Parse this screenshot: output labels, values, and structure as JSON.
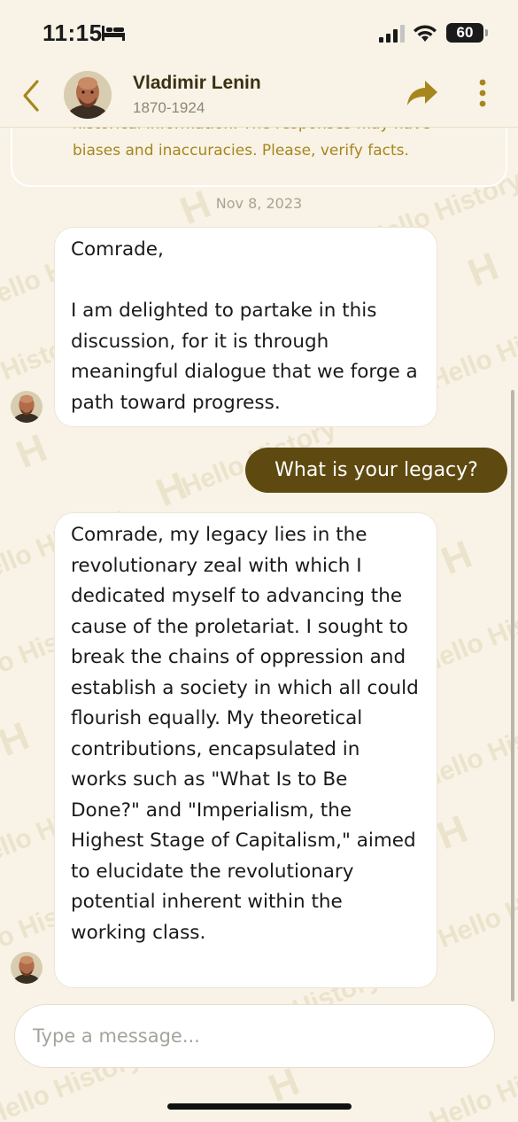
{
  "status_bar": {
    "time": "11:15",
    "battery": "60"
  },
  "header": {
    "name": "Vladimir Lenin",
    "years": "1870-1924"
  },
  "disclaimer": {
    "line1": "historical information. The responses may have",
    "line2": "biases and inaccuracies. Please, verify facts."
  },
  "date_label": "Nov 8, 2023",
  "messages": [
    {
      "from": "bot",
      "paragraphs": [
        "Comrade,",
        "I am delighted to partake in this discussion, for it is through meaningful dialogue that we forge a path toward progress."
      ]
    },
    {
      "from": "user",
      "text": "What is your legacy?"
    },
    {
      "from": "bot",
      "paragraphs": [
        "Comrade, my legacy lies in the revolutionary zeal with which I dedicated myself to advancing the cause of the proletariat. I sought to break the chains of oppression and establish a society in which all could flourish equally. My theoretical contributions, encapsulated in works such as \"What Is to Be Done?\" and \"Imperialism, the Highest Stage of Capitalism,\" aimed to elucidate the revolutionary potential inherent within the working class."
      ]
    }
  ],
  "input": {
    "placeholder": "Type a message..."
  },
  "watermark": {
    "word": "Hello History",
    "letter": "H"
  },
  "colors": {
    "background": "#f8f3e6",
    "accent": "#a6861d",
    "user_bubble": "#5e4a10",
    "header_name": "#3b3013"
  },
  "icons": [
    "bed-icon",
    "signal-icon",
    "wifi-icon",
    "battery-icon",
    "back-chevron-icon",
    "share-arrow-icon",
    "more-vertical-icon"
  ]
}
